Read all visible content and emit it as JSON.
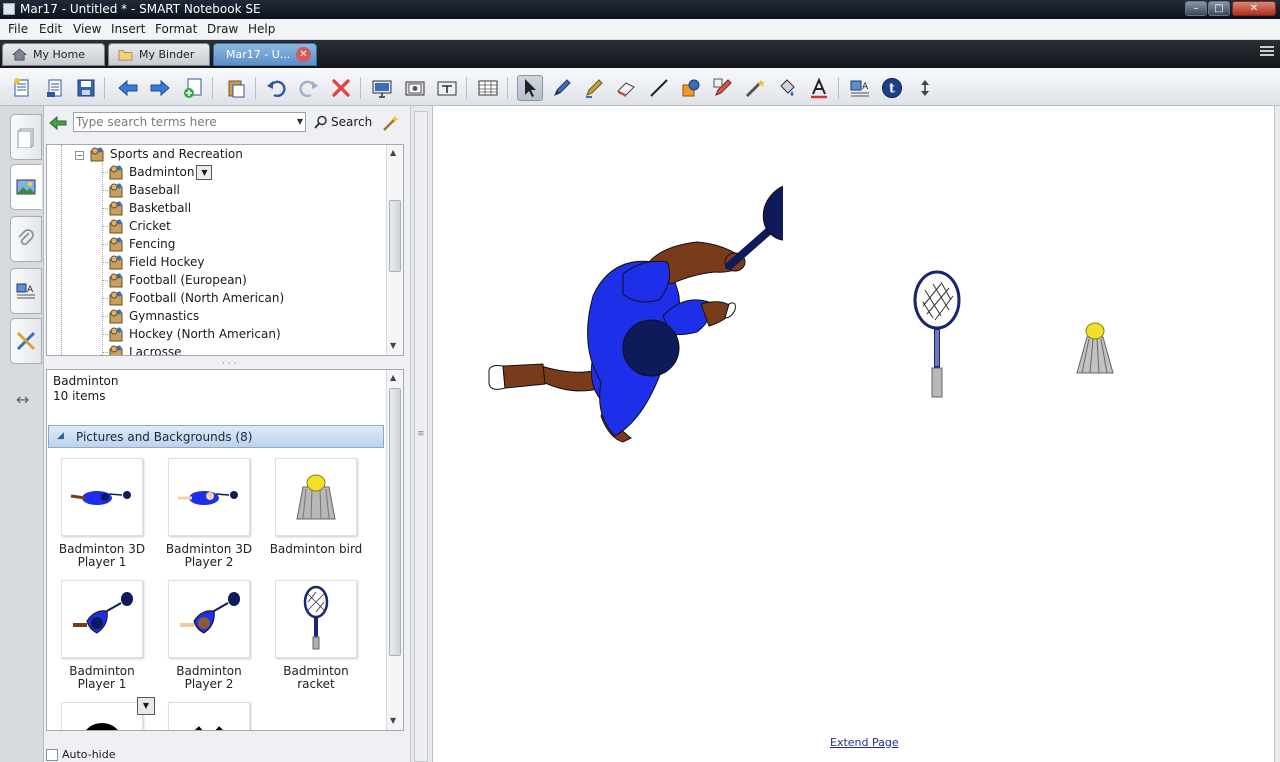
{
  "window": {
    "title": "Mar17 - Untitled * - SMART Notebook SE"
  },
  "menu": [
    "File",
    "Edit",
    "View",
    "Insert",
    "Format",
    "Draw",
    "Help"
  ],
  "tabs": [
    {
      "label": "My Home"
    },
    {
      "label": "My Binder"
    },
    {
      "label": "Mar17 - U...",
      "active": true
    }
  ],
  "toolbar": {
    "icons": [
      "new-page",
      "save",
      "back",
      "forward",
      "add-page",
      "paste",
      "undo",
      "redo",
      "delete",
      "screen-shade",
      "screen-capture",
      "full-screen",
      "table",
      "select",
      "pen",
      "creative-pen",
      "eraser",
      "line",
      "shapes",
      "magic-pen",
      "fill",
      "text",
      "properties",
      "t-icon",
      "move-toolbar"
    ]
  },
  "search": {
    "placeholder": "Type search terms here",
    "button_label": "Search"
  },
  "tree": {
    "parent": "Sports and Recreation",
    "children": [
      "Badminton",
      "Baseball",
      "Basketball",
      "Cricket",
      "Fencing",
      "Field Hockey",
      "Football (European)",
      "Football (North American)",
      "Gymnastics",
      "Hockey (North American)",
      "Lacrosse"
    ],
    "selected": "Badminton"
  },
  "items": {
    "title": "Badminton",
    "count": "10 items",
    "category": "Pictures and Backgrounds (8)",
    "thumbnails": [
      {
        "line1": "Badminton 3D",
        "line2": "Player 1"
      },
      {
        "line1": "Badminton 3D",
        "line2": "Player 2"
      },
      {
        "line1": "Badminton bird",
        "line2": ""
      },
      {
        "line1": "Badminton",
        "line2": "Player 1"
      },
      {
        "line1": "Badminton",
        "line2": "Player 2"
      },
      {
        "line1": "Badminton",
        "line2": "racket"
      }
    ]
  },
  "autohide": {
    "label": "Auto-hide",
    "checked": false
  },
  "canvas": {
    "extend_link": "Extend Page"
  },
  "colors": {
    "player_shirt": "#1d2fe8",
    "player_skin": "#7a3b1a",
    "racket_navy": "#0f1a5a",
    "accent_blue": "#4a82c4"
  }
}
